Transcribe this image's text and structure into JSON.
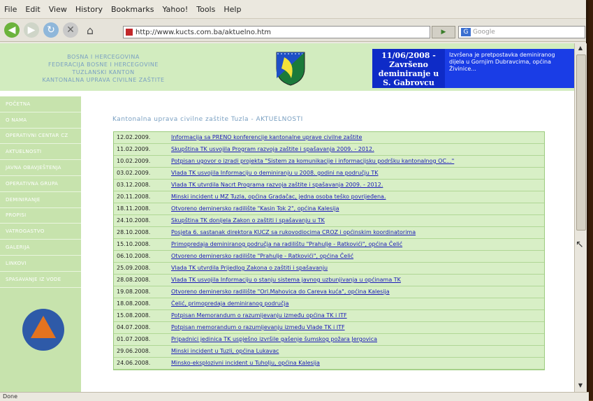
{
  "menu": [
    "File",
    "Edit",
    "View",
    "History",
    "Bookmarks",
    "Yahoo!",
    "Tools",
    "Help"
  ],
  "url": "http://www.kucts.com.ba/aktuelno.htm",
  "search_placeholder": "Google",
  "header": {
    "lines": [
      "BOSNA I HERCEGOVINA",
      "FEDERACIJA BOSNE I HERCEGOVINE",
      "TUZLANSKI KANTON",
      "KANTONALNA UPRAVA CIVILNE ZAŠTITE"
    ],
    "news_date": "11/06/2008 - Završeno deminiranje u S. Gabrovcu",
    "news_text": "Izvršena je pretpostavka deminiranog dijela u Gornjim Dubravcima, općina Živinice..."
  },
  "sidebar": [
    "POČETNA",
    "O NAMA",
    "OPERATIVNI CENTAR CZ",
    "AKTUELNOSTI",
    "JAVNA OBAVJEŠTENJA",
    "OPERATIVNA GRUPA",
    "DEMINIRANJE",
    "PROPISI",
    "VATROGASTVO",
    "GALERIJA",
    "LINKOVI",
    "SPASAVANJE IZ VODE"
  ],
  "page_title": "Kantonalna uprava civilne zaštite Tuzla - AKTUELNOSTI",
  "news": [
    {
      "date": "12.02.2009.",
      "title": "Informacija sa PRENO konferencije kantonalne uprave civilne zaštite"
    },
    {
      "date": "11.02.2009.",
      "title": "Skupština TK usvojila Program razvoja zaštite i spašavanja 2009. - 2012."
    },
    {
      "date": "10.02.2009.",
      "title": "Potpisan ugovor o izradi projekta \"Sistem za komunikacije i informacijsku podršku kantonalnog OC...\""
    },
    {
      "date": "03.02.2009.",
      "title": "Vlada TK usvojila Informaciju o deminiranju u 2008. godini na području TK"
    },
    {
      "date": "03.12.2008.",
      "title": "Vlada TK utvrdila Nacrt Programa razvoja zaštite i spašavanja 2009. - 2012."
    },
    {
      "date": "20.11.2008.",
      "title": "Minski incident u MZ Tuzla, općina Gradačac, jedna osoba teško povrijeđena."
    },
    {
      "date": "18.11.2008.",
      "title": "Otvoreno deminersko radilište \"Kasin Tok 2\", općina Kalesija"
    },
    {
      "date": "24.10.2008.",
      "title": "Skupština TK donijela Zakon o zaštiti i spašavanju u TK"
    },
    {
      "date": "28.10.2008.",
      "title": "Posjeta 6. sastanak direktora KUCZ sa rukovodiocima CROZ i općinskim koordinatorima"
    },
    {
      "date": "15.10.2008.",
      "title": "Primopredaja deminiranog područja na radilištu \"Prahulje - Ratkovići\", općina Čelić"
    },
    {
      "date": "06.10.2008.",
      "title": "Otvoreno deminersko radilište \"Prahulje - Ratkovići\", općina Čelić"
    },
    {
      "date": "25.09.2008.",
      "title": "Vlada TK utvrdila Prijedlog Zakona o zaštiti i spašavanju"
    },
    {
      "date": "28.08.2008.",
      "title": "Vlada TK usvojila Informaciju o stanju sistema javnog uzbunjivanja u općinama TK"
    },
    {
      "date": "19.08.2008.",
      "title": "Otvoreno deminersko radilište \"Orl.Mahovica do Careva kuća\", općina Kalesija"
    },
    {
      "date": "18.08.2008.",
      "title": "Čelić, primopredaja deminiranog područja"
    },
    {
      "date": "15.08.2008.",
      "title": "Potpisan Memorandum o razumijevanju između općina TK i ITF"
    },
    {
      "date": "04.07.2008.",
      "title": "Potpisan memorandum o razumijevanju između Vlade TK i ITF"
    },
    {
      "date": "01.07.2008.",
      "title": "Pripadnici jedinica TK uspješno izvršile gašenje šumskog požara Jergovica"
    },
    {
      "date": "29.06.2008.",
      "title": "Minski incident u Tuzli, općina Lukavac"
    },
    {
      "date": "24.06.2008.",
      "title": "Minsko-eksplozivni incident u Tuholju, općina Kalesija"
    }
  ],
  "status": "Done"
}
